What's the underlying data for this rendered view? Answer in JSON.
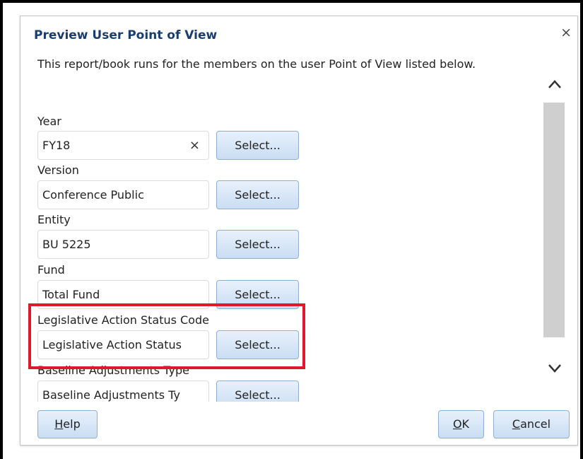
{
  "dialog": {
    "title": "Preview User Point of View",
    "close_glyph": "×",
    "description": "This report/book runs for the members on the user Point of View listed below."
  },
  "fields": [
    {
      "label": "Year",
      "value": "FY18",
      "clear_glyph": "×",
      "select_label": "Select..."
    },
    {
      "label": "Version",
      "value": "Conference Public",
      "select_label": "Select..."
    },
    {
      "label": "Entity",
      "value": "BU 5225",
      "select_label": "Select..."
    },
    {
      "label": "Fund",
      "value": "Total Fund",
      "select_label": "Select..."
    },
    {
      "label": "Legislative Action Status Code",
      "value": "Legislative Action Status",
      "select_label": "Select..."
    },
    {
      "label": "Baseline Adjustments Type",
      "value": "Baseline Adjustments Ty",
      "select_label": "Select..."
    }
  ],
  "footer": {
    "help": {
      "mnemonic": "H",
      "rest": "elp"
    },
    "ok": {
      "mnemonic": "O",
      "rest": "K"
    },
    "cancel": {
      "mnemonic": "C",
      "rest": "ancel"
    }
  },
  "icons": {
    "scroll_up": "chevron-up-icon",
    "scroll_down": "chevron-down-icon"
  },
  "colors": {
    "title": "#1a3d6e",
    "highlight": "#e0182d",
    "button_border": "#8fb0d2"
  }
}
